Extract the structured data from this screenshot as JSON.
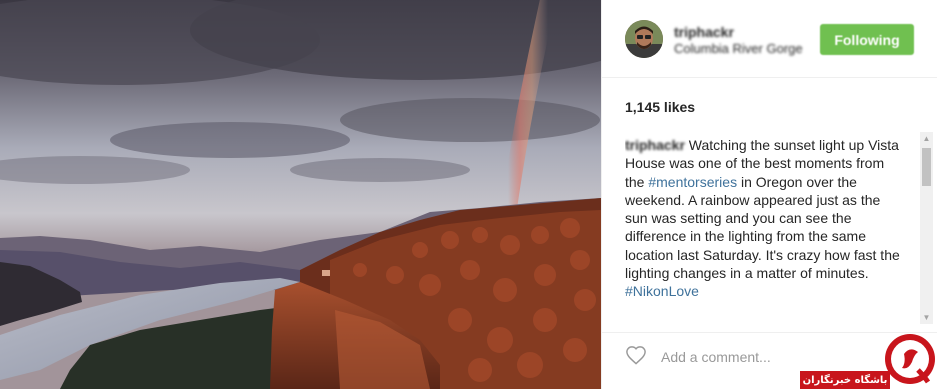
{
  "post": {
    "username": "triphackr",
    "location": "Columbia River Gorge",
    "follow_label": "Following",
    "likes": "1,145 likes",
    "caption": {
      "user": "triphackr",
      "text_1": " Watching the sunset light up Vista House was one of the best moments from the ",
      "hashtag_1": "#mentorseries",
      "text_2": " in Oregon over the weekend. A rainbow appeared just as the sun was setting and you can see the difference in the lighting from the same location last Saturday. It's crazy how fast the lighting changes in a matter of minutes. ",
      "hashtag_2": "#NikonLove"
    },
    "comment_placeholder": "Add a comment..."
  },
  "icons": {
    "like": "heart-outline-icon",
    "scroll_up": "triangle-up-icon",
    "scroll_down": "triangle-down-icon"
  },
  "watermark": {
    "text": "باشگاه خبرنگاران"
  },
  "colors": {
    "follow_button": "#70c050",
    "hashtag": "#3f729b",
    "text": "#262626",
    "placeholder": "#999999",
    "watermark_red": "#c8151c"
  }
}
